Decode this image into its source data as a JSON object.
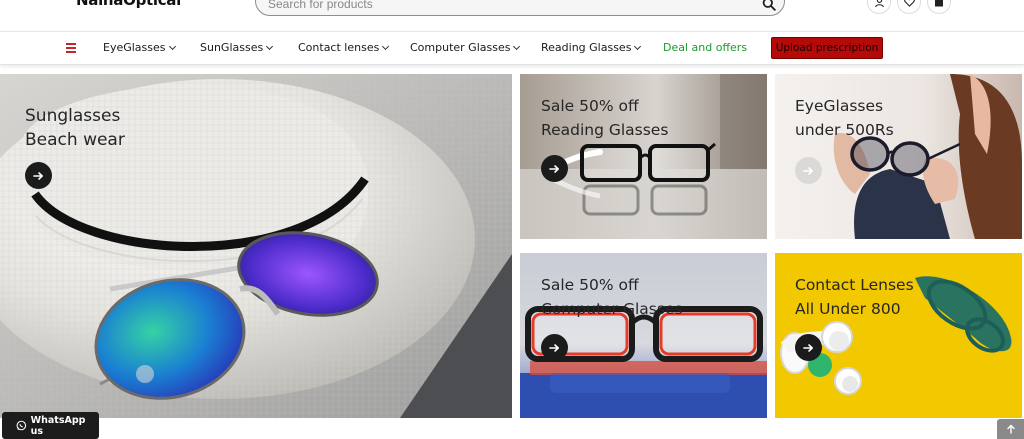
{
  "brand": {
    "logo_text": "NaînaOptical"
  },
  "search": {
    "placeholder": "Search for products"
  },
  "header_icons": [
    "user-icon",
    "heart-icon",
    "bag-icon"
  ],
  "nav": {
    "items": [
      {
        "label": "EyeGlasses"
      },
      {
        "label": "SunGlasses"
      },
      {
        "label": "Contact lenses"
      },
      {
        "label": "Computer Glasses"
      },
      {
        "label": "Reading Glasses"
      }
    ],
    "deal_label": "Deal and offers",
    "upload_label": "Upload prescription"
  },
  "banners": [
    {
      "line1": "Sunglasses",
      "line2": "Beach wear"
    },
    {
      "line1": "Sale 50% off",
      "line2": "Reading Glasses"
    },
    {
      "line1": "EyeGlasses",
      "line2": "under 500Rs"
    },
    {
      "line1": "Sale 50% off",
      "line2": "Computer Glasses"
    },
    {
      "line1": "Contact Lenses",
      "line2": "All Under 800"
    }
  ],
  "whatsapp": {
    "label": "WhatsApp us"
  },
  "colors": {
    "accent_red": "#b40a0a",
    "deal_green": "#1e9a2e",
    "contact_yellow": "#f2c800"
  }
}
